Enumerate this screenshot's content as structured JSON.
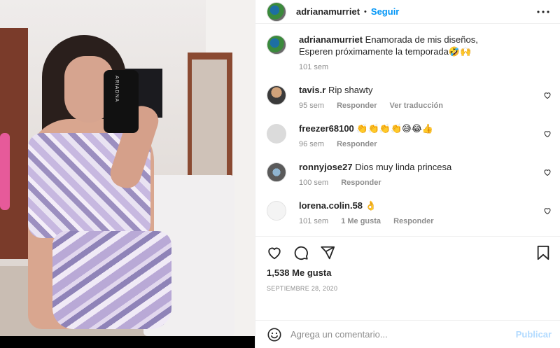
{
  "post": {
    "author": "adrianamurriet",
    "separator": "•",
    "follow_label": "Seguir",
    "caption_line1": "Enamorada de mis diseños,",
    "caption_line2": "Esperen próximamente la temporada🤣🙌",
    "caption_age": "101 sem",
    "likes": "1,538 Me gusta",
    "date": "SEPTIEMBRE 28, 2020",
    "phone_case_text": "ARIADNA"
  },
  "comments": [
    {
      "user": "tavis.r",
      "text": "Rip shawty",
      "age": "95 sem",
      "reply": "Responder",
      "translate": "Ver traducción",
      "likes": ""
    },
    {
      "user": "freezer68100",
      "text": "👏👏👏👏😅😂👍",
      "age": "96 sem",
      "reply": "Responder",
      "translate": "",
      "likes": ""
    },
    {
      "user": "ronnyjose27",
      "text": "Dios muy linda princesa",
      "age": "100 sem",
      "reply": "Responder",
      "translate": "",
      "likes": ""
    },
    {
      "user": "lorena.colin.58",
      "text": "👌",
      "age": "101 sem",
      "reply": "Responder",
      "translate": "",
      "likes": "1 Me gusta"
    }
  ],
  "composer": {
    "placeholder": "Agrega un comentario...",
    "publish_label": "Publicar"
  },
  "icons": {
    "more": "more-horizontal-icon",
    "like": "heart-icon",
    "comment": "comment-icon",
    "share": "send-icon",
    "save": "bookmark-icon",
    "emoji": "emoji-icon"
  },
  "colors": {
    "accent": "#0095f6",
    "publish_disabled": "#b3dbff",
    "muted": "#8e8e8e",
    "text": "#262626"
  }
}
